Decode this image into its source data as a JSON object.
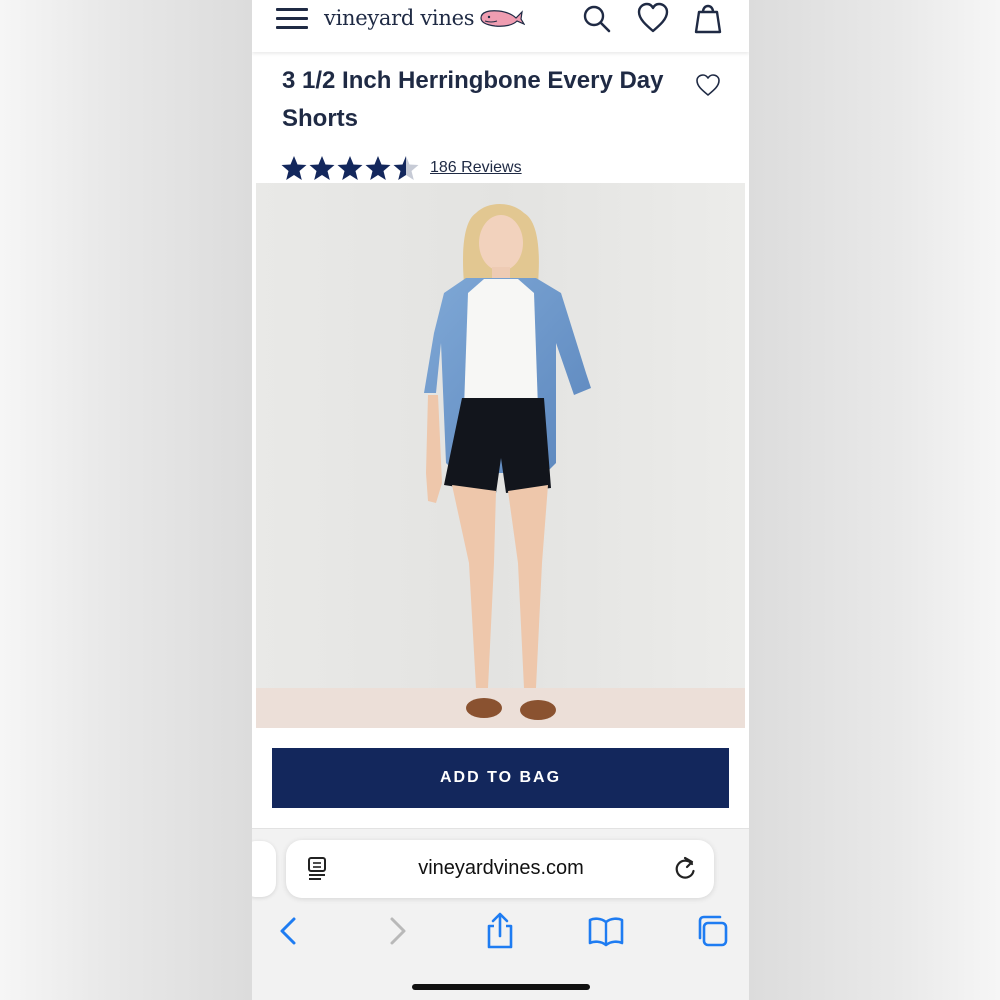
{
  "header": {
    "logo_text": "vineyard vines",
    "icons": [
      "menu-icon",
      "whale-logo-icon",
      "search-icon",
      "heart-icon",
      "shopping-bag-icon"
    ]
  },
  "product": {
    "title": "3 1/2 Inch Herringbone Every Day Shorts",
    "rating": 4.5,
    "reviews_label": "186 Reviews",
    "add_to_bag_label": "ADD TO BAG"
  },
  "browser": {
    "url": "vineyardvines.com",
    "icons": [
      "reader-icon",
      "reload-icon",
      "back-icon",
      "forward-icon",
      "share-icon",
      "bookmarks-icon",
      "tabs-icon"
    ]
  },
  "colors": {
    "navy": "#1f2a44",
    "button": "#13275c",
    "safari_blue": "#1e7cf2",
    "whale_pink": "#e88aa0"
  }
}
